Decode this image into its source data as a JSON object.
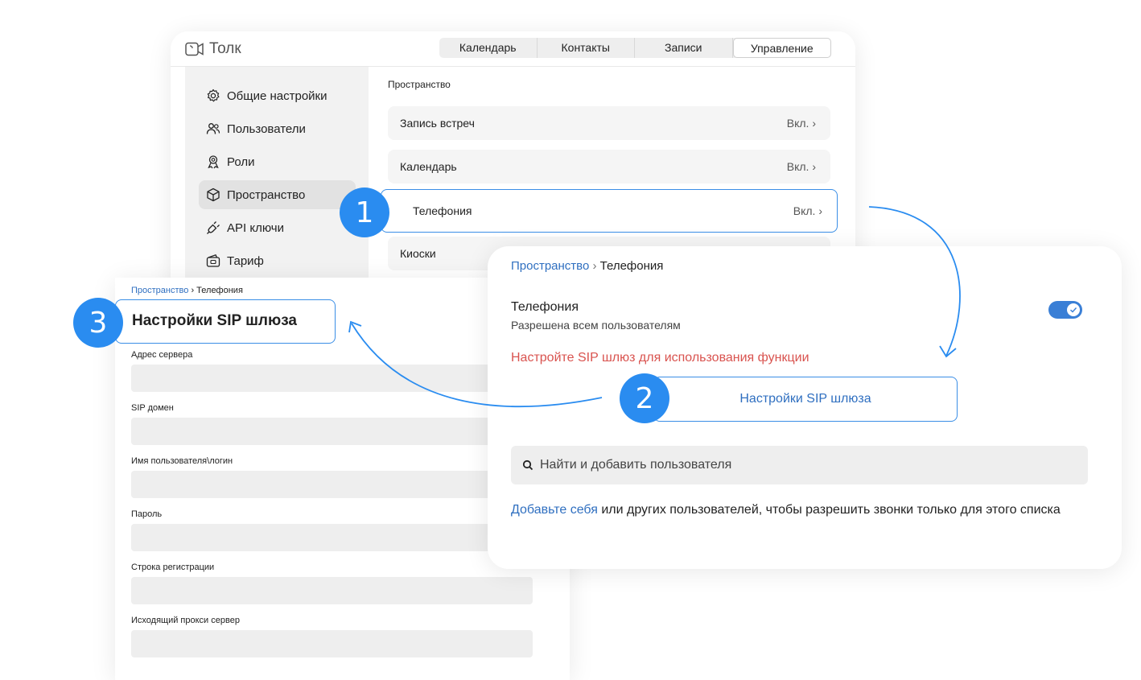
{
  "app": {
    "logo_text": "Толк"
  },
  "nav": {
    "tabs": [
      "Календарь",
      "Контакты",
      "Записи",
      "Управление"
    ],
    "active": "Управление"
  },
  "sidebar": {
    "items": [
      {
        "label": "Общие настройки",
        "icon": "gear-icon"
      },
      {
        "label": "Пользователи",
        "icon": "users-icon"
      },
      {
        "label": "Роли",
        "icon": "roles-icon"
      },
      {
        "label": "Пространство",
        "icon": "cube-icon",
        "active": true
      },
      {
        "label": "API ключи",
        "icon": "plug-icon"
      },
      {
        "label": "Тариф",
        "icon": "wallet-icon"
      }
    ]
  },
  "space": {
    "title": "Пространство",
    "rows": [
      {
        "label": "Запись встреч",
        "value": "Вкл."
      },
      {
        "label": "Календарь",
        "value": "Вкл."
      },
      {
        "label": "Телефония",
        "value": "Вкл."
      },
      {
        "label": "Киоски",
        "value": ""
      }
    ]
  },
  "sip": {
    "breadcrumb_parent": "Пространство",
    "breadcrumb_current": "Телефония",
    "title": "Настройки SIP шлюза",
    "fields": [
      "Адрес сервера",
      "SIP домен",
      "Имя пользователя\\логин",
      "Пароль",
      "Строка регистрации",
      "Исходящий прокси сервер"
    ]
  },
  "telephony": {
    "breadcrumb_parent": "Пространство",
    "breadcrumb_current": "Телефония",
    "title": "Телефония",
    "subtitle": "Разрешена всем пользователям",
    "toggle_on": true,
    "warning": "Настройте SIP шлюз для использования функции",
    "sip_button": "Настройки SIP шлюза",
    "search_placeholder": "Найти и добавить пользователя",
    "hint_link": "Добавьте себя",
    "hint_text": " или других пользователей, чтобы разрешить звонки только для этого списка"
  },
  "badges": [
    "1",
    "2",
    "3"
  ],
  "colors": {
    "accent": "#2a8cf0",
    "link": "#2f6fc0",
    "warning": "#d9534f",
    "toggle": "#3a7fd6"
  }
}
